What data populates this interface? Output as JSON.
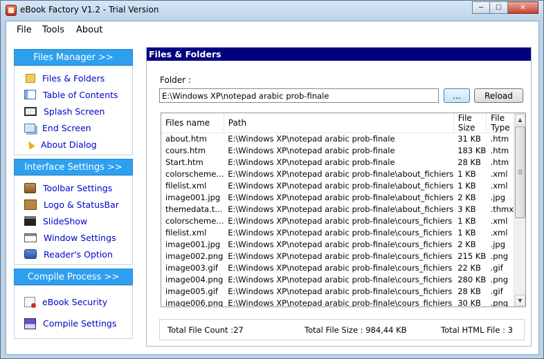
{
  "window": {
    "title": "eBook Factory  V1.2 - Trial Version",
    "minimize": "─",
    "maximize": "☐",
    "close": "✕"
  },
  "menu": [
    "File",
    "Tools",
    "About"
  ],
  "sidebar": {
    "files_manager": {
      "title": "Files Manager >>",
      "items": [
        {
          "label": "Files & Folders",
          "icon": "folder-icon"
        },
        {
          "label": "Table of Contents",
          "icon": "toc-icon"
        },
        {
          "label": "Splash Screen",
          "icon": "splash-screen-icon"
        },
        {
          "label": "End Screen",
          "icon": "end-screen-icon"
        },
        {
          "label": "About Dialog",
          "icon": "about-dialog-icon"
        }
      ]
    },
    "interface_settings": {
      "title": "Interface Settings >>",
      "items": [
        {
          "label": "Toolbar Settings",
          "icon": "toolbar-icon"
        },
        {
          "label": "Logo & StatusBar",
          "icon": "logo-icon"
        },
        {
          "label": "SlideShow",
          "icon": "clapperboard-icon"
        },
        {
          "label": "Window Settings",
          "icon": "window-icon"
        },
        {
          "label": "Reader's Option",
          "icon": "briefcase-icon"
        }
      ]
    },
    "compile_process": {
      "title": "Compile Process >>",
      "items": [
        {
          "label": "eBook Security",
          "icon": "security-icon"
        },
        {
          "label": "Compile Settings",
          "icon": "floppy-disk-icon"
        }
      ]
    }
  },
  "main": {
    "title": "Files & Folders",
    "folder_label": "Folder :",
    "folder_value": "E:\\Windows XP\\notepad arabic prob-finale",
    "browse_label": "...",
    "reload_label": "Reload",
    "columns": [
      "Files name",
      "Path",
      "File Size",
      "File Type"
    ],
    "rows": [
      [
        "about.htm",
        "E:\\Windows XP\\notepad arabic prob-finale",
        "31 KB",
        ".htm"
      ],
      [
        "cours.htm",
        "E:\\Windows XP\\notepad arabic prob-finale",
        "183 KB",
        ".htm"
      ],
      [
        "Start.htm",
        "E:\\Windows XP\\notepad arabic prob-finale",
        "28 KB",
        ".htm"
      ],
      [
        "colorscheme...",
        "E:\\Windows XP\\notepad arabic prob-finale\\about_fichiers",
        "1 KB",
        ".xml"
      ],
      [
        "filelist.xml",
        "E:\\Windows XP\\notepad arabic prob-finale\\about_fichiers",
        "1 KB",
        ".xml"
      ],
      [
        "image001.jpg",
        "E:\\Windows XP\\notepad arabic prob-finale\\about_fichiers",
        "2 KB",
        ".jpg"
      ],
      [
        "themedata.t...",
        "E:\\Windows XP\\notepad arabic prob-finale\\about_fichiers",
        "3 KB",
        ".thmx"
      ],
      [
        "colorscheme...",
        "E:\\Windows XP\\notepad arabic prob-finale\\cours_fichiers",
        "1 KB",
        ".xml"
      ],
      [
        "filelist.xml",
        "E:\\Windows XP\\notepad arabic prob-finale\\cours_fichiers",
        "1 KB",
        ".xml"
      ],
      [
        "image001.jpg",
        "E:\\Windows XP\\notepad arabic prob-finale\\cours_fichiers",
        "2 KB",
        ".jpg"
      ],
      [
        "image002.png",
        "E:\\Windows XP\\notepad arabic prob-finale\\cours_fichiers",
        "215 KB",
        ".png"
      ],
      [
        "image003.gif",
        "E:\\Windows XP\\notepad arabic prob-finale\\cours_fichiers",
        "22 KB",
        ".gif"
      ],
      [
        "image004.png",
        "E:\\Windows XP\\notepad arabic prob-finale\\cours_fichiers",
        "280 KB",
        ".png"
      ],
      [
        "image005.gif",
        "E:\\Windows XP\\notepad arabic prob-finale\\cours_fichiers",
        "28 KB",
        ".gif"
      ],
      [
        "image006.png",
        "E:\\Windows XP\\notepad arabic prob-finale\\cours_fichiers",
        "30 KB",
        ".png"
      ]
    ],
    "status": {
      "count": "Total File Count :27",
      "size": "Total File Size : 984,44 KB",
      "html": "Total HTML File : 3"
    }
  }
}
